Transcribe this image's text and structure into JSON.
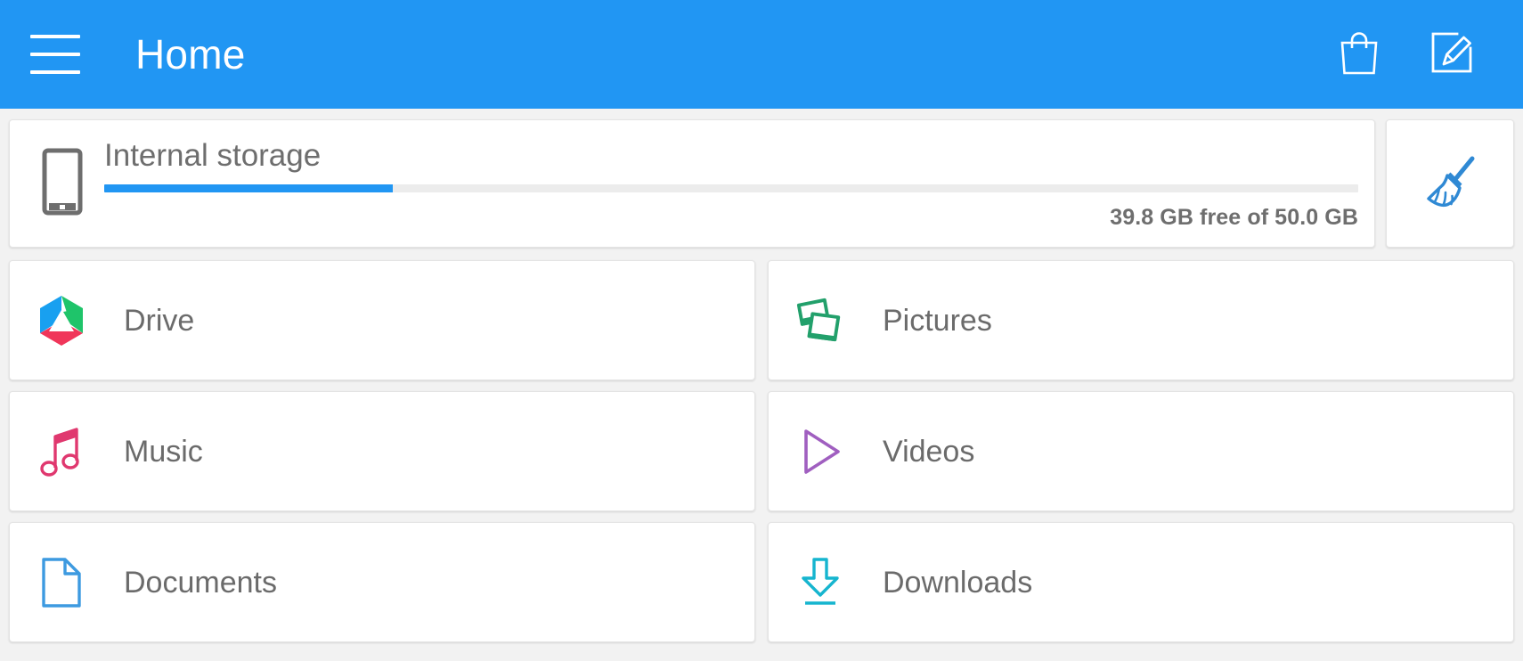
{
  "appbar": {
    "title": "Home",
    "menu_icon": "hamburger-menu-icon",
    "background_color": "#2196f3",
    "actions": [
      {
        "name": "shopping-bag",
        "icon": "shopping-bag-icon"
      },
      {
        "name": "edit",
        "icon": "edit-square-icon"
      }
    ]
  },
  "storage": {
    "icon": "phone-icon",
    "title": "Internal storage",
    "free_text": "39.8 GB free of 50.0 GB",
    "used_percent": 23,
    "free_value": "39.8 GB",
    "total_value": "50.0 GB",
    "bar_color": "#2196f3",
    "track_color": "#ececec"
  },
  "clean": {
    "icon": "broom-icon",
    "color": "#2f89d4"
  },
  "shortcuts": [
    {
      "label": "Drive",
      "icon": "drive-hexagon-icon",
      "color": "#2196f3"
    },
    {
      "label": "Pictures",
      "icon": "pictures-icon",
      "color": "#22a06b"
    },
    {
      "label": "Music",
      "icon": "music-note-icon",
      "color": "#e0386f"
    },
    {
      "label": "Videos",
      "icon": "play-triangle-icon",
      "color": "#a05fc0"
    },
    {
      "label": "Documents",
      "icon": "document-page-icon",
      "color": "#3d9ae0"
    },
    {
      "label": "Downloads",
      "icon": "download-arrow-icon",
      "color": "#16b5cf"
    }
  ]
}
